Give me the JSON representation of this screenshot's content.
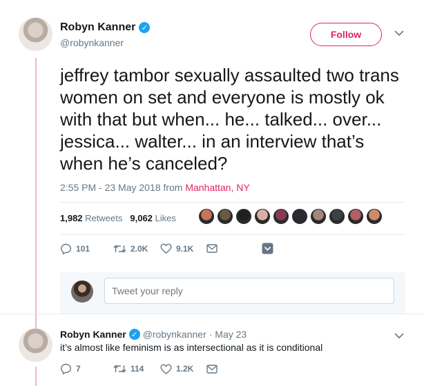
{
  "author": {
    "name": "Robyn Kanner",
    "handle": "@robynkanner"
  },
  "follow_label": "Follow",
  "tweet": {
    "text": "jeffrey tambor sexually assaulted two trans women on set and everyone is mostly ok with that but when... he... talked... over... jessica... walter... in an interview that’s when he’s canceled?",
    "time_date": "2:55 PM - 23 May 2018 from ",
    "location": "Manhattan, NY"
  },
  "stats": {
    "retweets_count": "1,982",
    "retweets_label": "Retweets",
    "likes_count": "9,062",
    "likes_label": "Likes"
  },
  "likers_colors": [
    "#c9735b",
    "#6a5a44",
    "#1d1f22",
    "#d8b0a2",
    "#8a3b52",
    "#2c2a30",
    "#a4877a",
    "#3c4148",
    "#b35f67",
    "#d18a67"
  ],
  "actions": {
    "replies": "101",
    "retweets": "2.0K",
    "likes": "9.1K"
  },
  "composer": {
    "placeholder": "Tweet your reply"
  },
  "reply": {
    "name": "Robyn Kanner",
    "handle": "@robynkanner",
    "date": "· May 23",
    "text": "it’s almost like feminism is as intersectional as it is conditional",
    "actions": {
      "replies": "7",
      "retweets": "114",
      "likes": "1.2K"
    }
  },
  "colors": {
    "accent": "#e0245e",
    "verified": "#1da1f2",
    "secondary_text": "#657786"
  }
}
